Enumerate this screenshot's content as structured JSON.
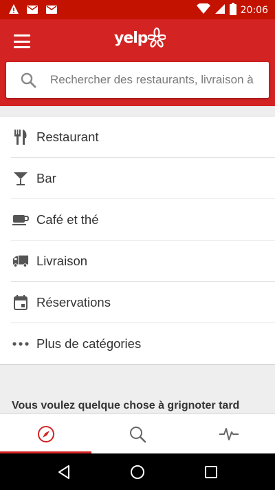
{
  "status_bar": {
    "time": "20:06",
    "icons": [
      "warning-icon",
      "mail-icon",
      "mail-icon",
      "wifi-icon",
      "signal-icon",
      "battery-icon"
    ]
  },
  "app_bar": {
    "logo_text": "yelp",
    "search_placeholder": "Rechercher des restaurants, livraison à"
  },
  "categories": [
    {
      "icon": "fork-knife-icon",
      "label": "Restaurant"
    },
    {
      "icon": "cocktail-icon",
      "label": "Bar"
    },
    {
      "icon": "coffee-cup-icon",
      "label": "Café et thé"
    },
    {
      "icon": "delivery-truck-icon",
      "label": "Livraison"
    },
    {
      "icon": "calendar-icon",
      "label": "Réservations"
    },
    {
      "icon": "more-dots-icon",
      "label": "Plus de catégories"
    }
  ],
  "section": {
    "title": "Vous voulez quelque chose à grignoter tard"
  },
  "tabs": [
    {
      "icon": "compass-icon",
      "active": true
    },
    {
      "icon": "search-icon",
      "active": false
    },
    {
      "icon": "activity-icon",
      "active": false
    }
  ],
  "colors": {
    "brand_red": "#d32323",
    "status_red": "#c41200"
  }
}
